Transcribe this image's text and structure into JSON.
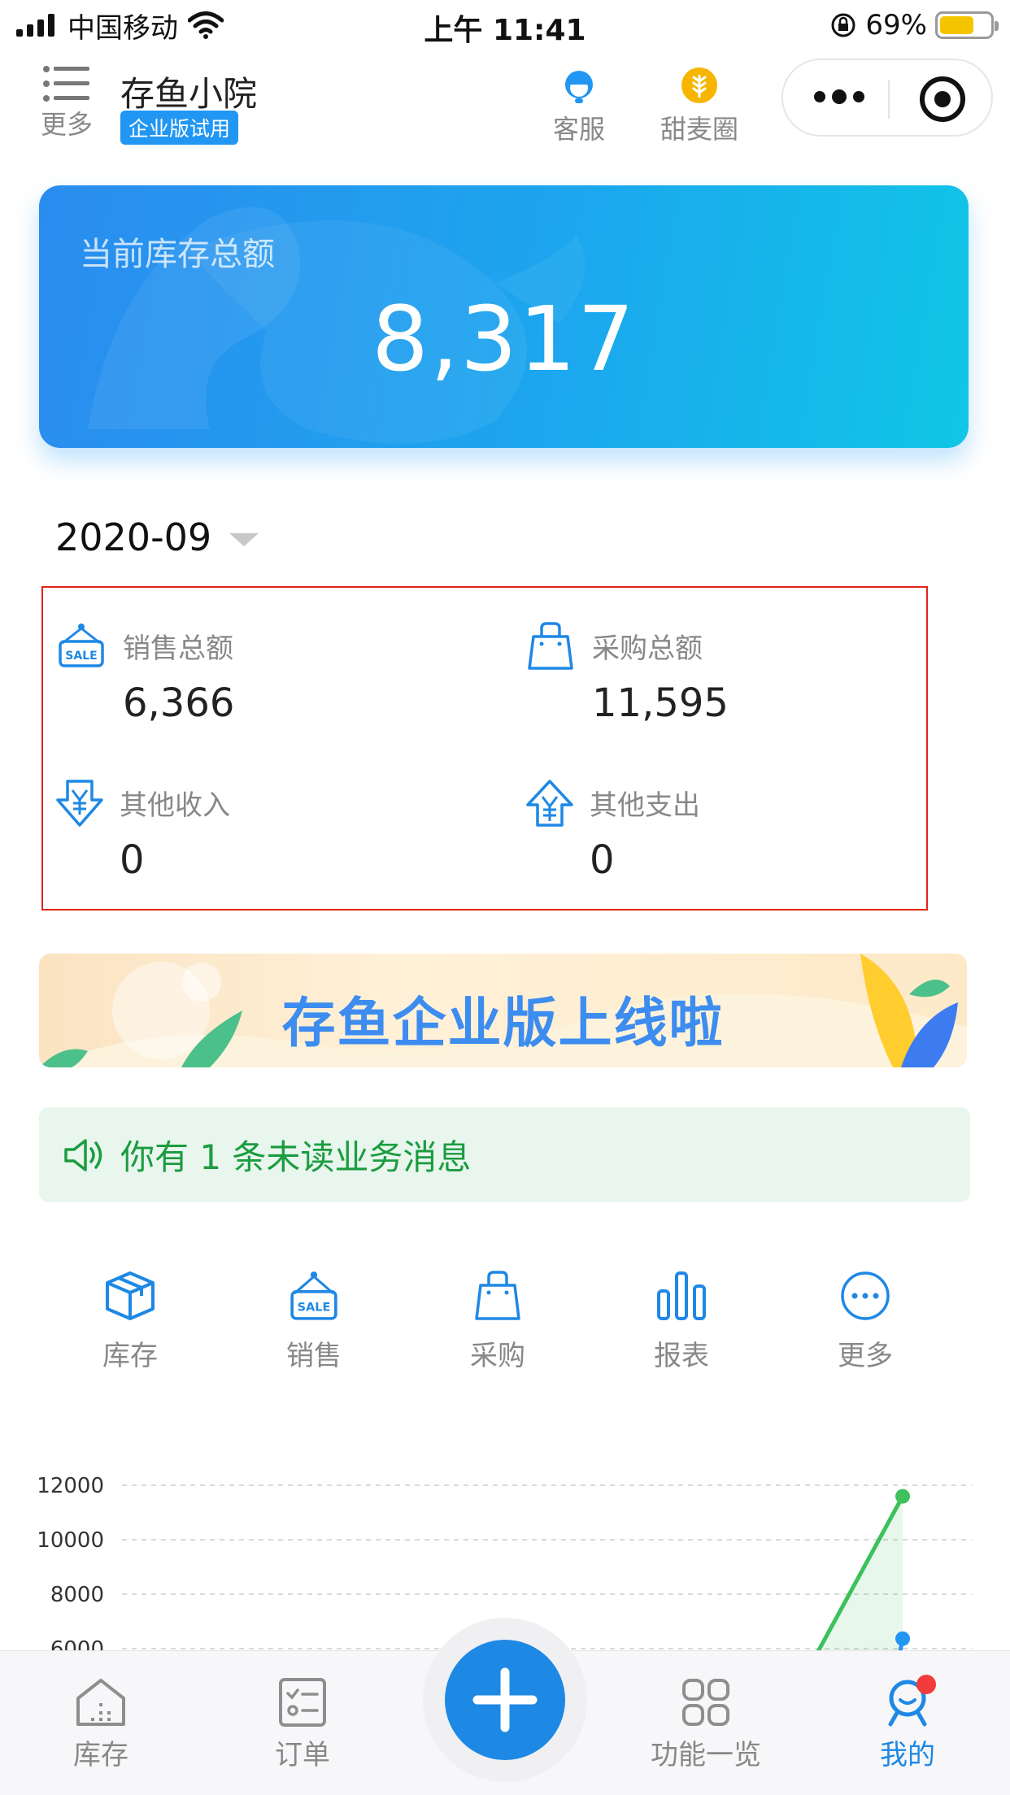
{
  "status_bar": {
    "carrier": "中国移动",
    "time": "上午 11:41",
    "battery_percent": "69%",
    "battery_level": 0.69
  },
  "header": {
    "menu_label": "更多",
    "shop_name": "存鱼小院",
    "edition_badge": "企业版试用",
    "service_label": "客服",
    "circle_label": "甜麦圈"
  },
  "inventory_card": {
    "title": "当前库存总额",
    "value": "8,317"
  },
  "period": {
    "month": "2020-09"
  },
  "stats": [
    {
      "label": "销售总额",
      "value": "6,366",
      "icon": "sale-sign-icon"
    },
    {
      "label": "采购总额",
      "value": "11,595",
      "icon": "shopping-bag-icon"
    },
    {
      "label": "其他收入",
      "value": "0",
      "icon": "yen-in-icon"
    },
    {
      "label": "其他支出",
      "value": "0",
      "icon": "yen-out-icon"
    }
  ],
  "banner": {
    "text": "存鱼企业版上线啦"
  },
  "notice": {
    "text": "你有 1 条未读业务消息"
  },
  "functions": [
    {
      "label": "库存",
      "icon": "box-icon"
    },
    {
      "label": "销售",
      "icon": "sale-sign-icon"
    },
    {
      "label": "采购",
      "icon": "shopping-bag-icon"
    },
    {
      "label": "报表",
      "icon": "bar-chart-icon"
    },
    {
      "label": "更多",
      "icon": "more-circle-icon"
    }
  ],
  "chart_data": {
    "type": "line",
    "y_ticks": [
      "12000",
      "10000",
      "8000",
      "6000"
    ],
    "ylim": [
      6000,
      12000
    ],
    "series": [
      {
        "color": "#3cc15d",
        "points": [
          [
            0.93,
            5500
          ],
          [
            1.0,
            11595
          ]
        ]
      },
      {
        "color": "#2196f3",
        "points": [
          [
            1.0,
            6366
          ]
        ]
      }
    ],
    "grid": true
  },
  "tabbar": {
    "tabs": [
      {
        "label": "库存",
        "icon": "warehouse-icon",
        "active": false
      },
      {
        "label": "订单",
        "icon": "order-list-icon",
        "active": false
      },
      {
        "label": "功能一览",
        "icon": "grid-icon",
        "active": false
      },
      {
        "label": "我的",
        "icon": "profile-icon",
        "active": true
      }
    ],
    "fab_icon": "plus-icon"
  }
}
